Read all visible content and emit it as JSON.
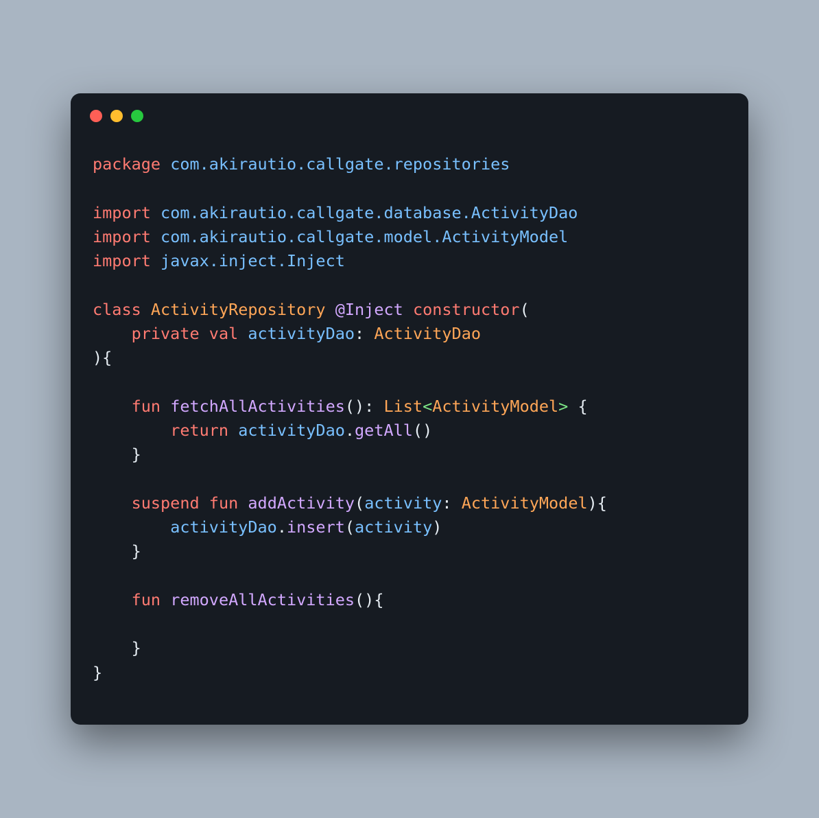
{
  "code": {
    "l1_kw": "package",
    "l1_pkg": "com.akirautio.callgate.repositories",
    "l3_kw": "import",
    "l3_pkg": "com.akirautio.callgate.database.ActivityDao",
    "l4_kw": "import",
    "l4_pkg": "com.akirautio.callgate.model.ActivityModel",
    "l5_kw": "import",
    "l5_pkg": "javax.inject.Inject",
    "l7_kw": "class",
    "l7_cls": "ActivityRepository",
    "l7_ann": "@Inject",
    "l7_ctor": "constructor",
    "l7_p1": "(",
    "l8_kw1": "private",
    "l8_kw2": "val",
    "l8_id": "activityDao",
    "l8_colon": ":",
    "l8_type": "ActivityDao",
    "l9_p": "){",
    "l11_kw": "fun",
    "l11_fn": "fetchAllActivities",
    "l11_p1": "():",
    "l11_type": "List",
    "l11_lt": "<",
    "l11_gtype": "ActivityModel",
    "l11_gt": ">",
    "l11_ob": " {",
    "l12_kw": "return",
    "l12_id": "activityDao",
    "l12_dot": ".",
    "l12_fn": "getAll",
    "l12_p": "()",
    "l13_cb": "}",
    "l15_kw1": "suspend",
    "l15_kw2": "fun",
    "l15_fn": "addActivity",
    "l15_p1": "(",
    "l15_param": "activity",
    "l15_colon": ":",
    "l15_type": "ActivityModel",
    "l15_p2": "){",
    "l16_id": "activityDao",
    "l16_dot": ".",
    "l16_fn": "insert",
    "l16_p1": "(",
    "l16_arg": "activity",
    "l16_p2": ")",
    "l17_cb": "}",
    "l19_kw": "fun",
    "l19_fn": "removeAllActivities",
    "l19_p": "(){",
    "l21_cb": "}",
    "l22_cb": "}"
  }
}
